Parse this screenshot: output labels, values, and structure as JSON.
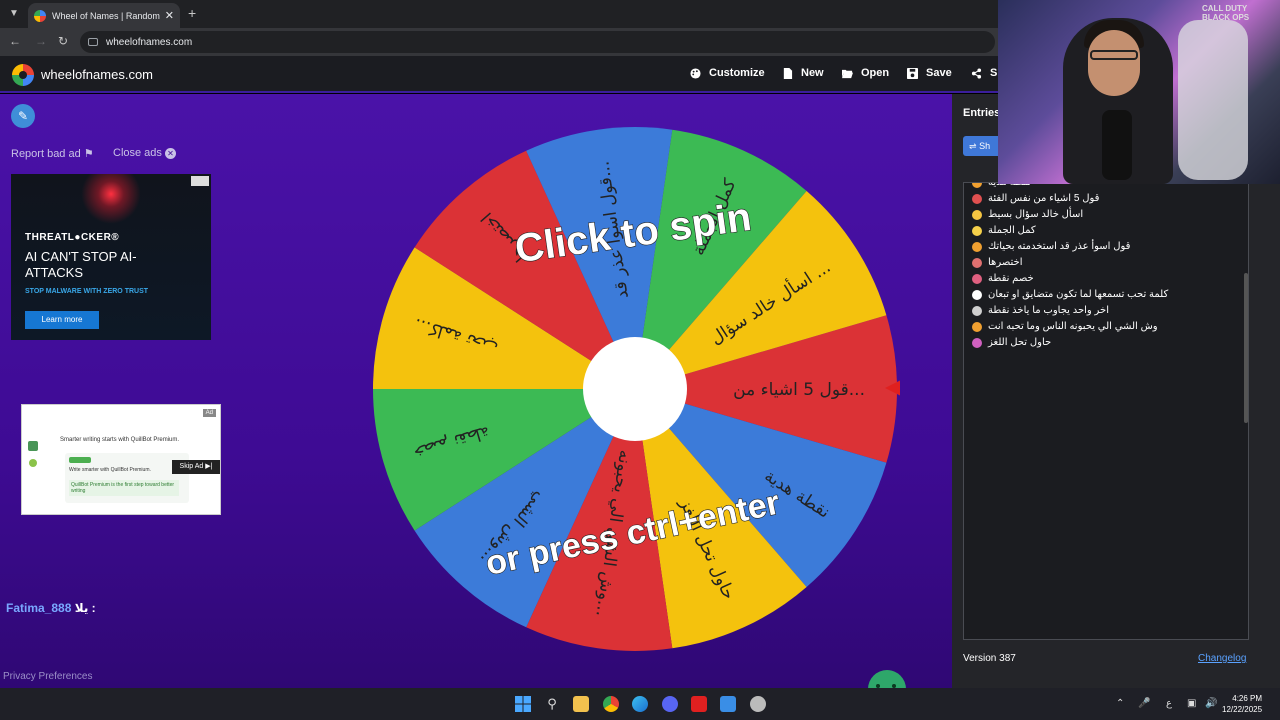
{
  "browser": {
    "tab_title": "Wheel of Names | Random nam",
    "url": "wheelofnames.com"
  },
  "header": {
    "brand": "wheelofnames.com",
    "customize": "Customize",
    "new": "New",
    "open": "Open",
    "save": "Save",
    "share": "Sh"
  },
  "sidebar": {
    "report_bad_ad": "Report bad ad",
    "close_ads": "Close ads"
  },
  "ad1": {
    "brand": "THREATL●CKER®",
    "headline": "AI CAN'T STOP AI-ATTACKS",
    "sub": "STOP MALWARE WITH ZERO TRUST",
    "button": "Learn more"
  },
  "ad2": {
    "label": "Ad",
    "headline": "Smarter writing starts with QuillBot Premium.",
    "line1": "Write smarter with QuillBot Premium.",
    "line2": "QuillBot Premium is the first step toward better writing",
    "skip": "Skip Ad ▶|"
  },
  "chat": {
    "user": "Fatima_888",
    "text": "يلا : "
  },
  "footer": {
    "privacy": "Privacy Preferences"
  },
  "wheel": {
    "line1": "Click to spin",
    "line2": "or press ctrl+enter",
    "segments": [
      {
        "label": "قول 5 اشياء من...",
        "color": "#db3236"
      },
      {
        "label": "نقطة هدية",
        "color": "#3c7bd9"
      },
      {
        "label": "حاول تحل اللغز",
        "color": "#f4c20d"
      },
      {
        "label": "وش الشي الي يحبونه...",
        "color": "#db3236"
      },
      {
        "label": "وش الشي...",
        "color": "#3c7bd9"
      },
      {
        "label": "خصم نقطة",
        "color": "#3cba54"
      },
      {
        "label": "كلمة تحب...",
        "color": "#f4c20d"
      },
      {
        "label": "اختصرها",
        "color": "#db3236"
      },
      {
        "label": "قول اسوأ عذر قد...",
        "color": "#3c7bd9"
      },
      {
        "label": "كمل الجملة",
        "color": "#3cba54"
      },
      {
        "label": "اسأل خالد سؤال ...",
        "color": "#f4c20d"
      }
    ]
  },
  "entries": {
    "tab_label": "Entries",
    "shuffle_label": "Sh",
    "items": [
      "نقطة هدية",
      "قول 5 اشياء من نفس الفئة",
      "اسأل خالد سؤال بسيط",
      "كمل الجملة",
      "قول اسوأ عذر قد استخدمته بحياتك",
      "اختصرها",
      "خصم نقطة",
      "كلمة تحب تسمعها لما تكون متضايق او تبعان",
      "اخر واحد يجاوب ما ياخذ نقطة",
      "وش الشي الي يحبونه الناس وما تحبه انت",
      "حاول تحل اللغز"
    ],
    "emoji_colors": [
      "#f0a030",
      "#e05050",
      "#f5c542",
      "#f5d04a",
      "#f0a030",
      "#e07070",
      "#e06080",
      "#ffffff",
      "#cfcfcf",
      "#f0a030",
      "#d060c0"
    ],
    "version": "Version 387",
    "changelog": "Changelog"
  },
  "webcam": {
    "poster": "CALL DUTY BLACK OPS"
  },
  "taskbar": {
    "lang": "ع",
    "time": "4:26 PM",
    "date": "12/22/2025"
  }
}
